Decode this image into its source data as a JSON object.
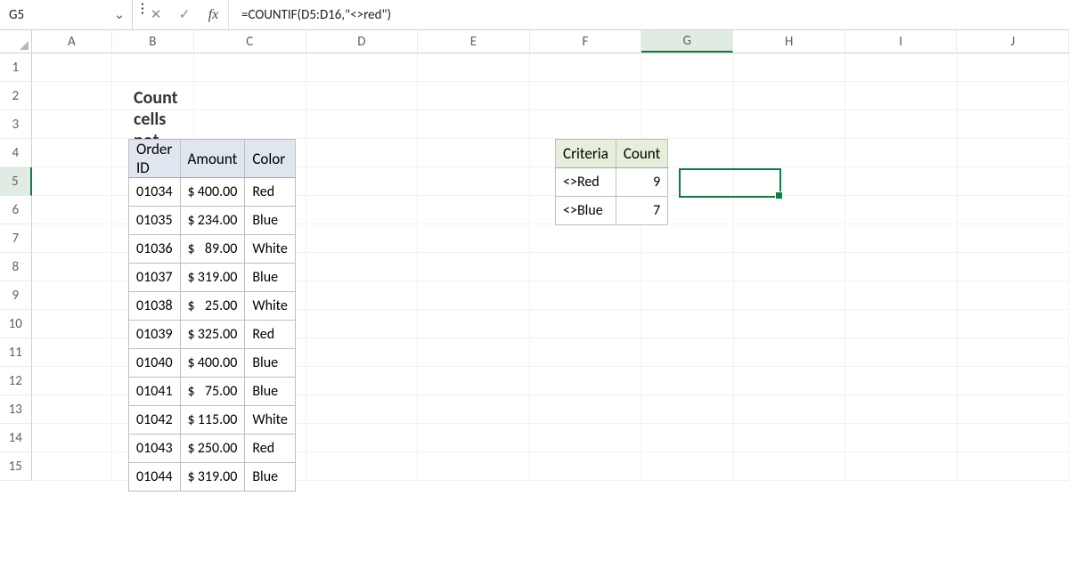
{
  "name_box": "G5",
  "formula": "=COUNTIF(D5:D16,\"<>red\")",
  "columns": [
    "A",
    "B",
    "C",
    "D",
    "E",
    "F",
    "G",
    "H",
    "I",
    "J"
  ],
  "active_col": "G",
  "row_labels": [
    "1",
    "2",
    "3",
    "4",
    "5",
    "6",
    "7",
    "8",
    "9",
    "10",
    "11",
    "12",
    "13",
    "14",
    "15"
  ],
  "active_row": "5",
  "title": "Count cells not equal to",
  "main_headers": {
    "id": "Order ID",
    "amount": "Amount",
    "color": "Color"
  },
  "main_rows": [
    {
      "id": "01034",
      "amount": "400.00",
      "color": "Red"
    },
    {
      "id": "01035",
      "amount": "234.00",
      "color": "Blue"
    },
    {
      "id": "01036",
      "amount": "89.00",
      "color": "White"
    },
    {
      "id": "01037",
      "amount": "319.00",
      "color": "Blue"
    },
    {
      "id": "01038",
      "amount": "25.00",
      "color": "White"
    },
    {
      "id": "01039",
      "amount": "325.00",
      "color": "Red"
    },
    {
      "id": "01040",
      "amount": "400.00",
      "color": "Blue"
    },
    {
      "id": "01041",
      "amount": "75.00",
      "color": "Blue"
    },
    {
      "id": "01042",
      "amount": "115.00",
      "color": "White"
    },
    {
      "id": "01043",
      "amount": "250.00",
      "color": "Red"
    },
    {
      "id": "01044",
      "amount": "319.00",
      "color": "Blue"
    }
  ],
  "currency": "$",
  "crit_headers": {
    "criteria": "Criteria",
    "count": "Count"
  },
  "crit_rows": [
    {
      "criteria": "<>Red",
      "count": "9"
    },
    {
      "criteria": "<>Blue",
      "count": "7"
    }
  ],
  "icons": {
    "dd": "⌄",
    "cancel": "✕",
    "enter": "✓",
    "fx": "fx"
  },
  "chart_data": {
    "type": "table",
    "title": "Count cells not equal to",
    "tables": [
      {
        "name": "orders",
        "columns": [
          "Order ID",
          "Amount",
          "Color"
        ],
        "rows": [
          [
            "01034",
            400.0,
            "Red"
          ],
          [
            "01035",
            234.0,
            "Blue"
          ],
          [
            "01036",
            89.0,
            "White"
          ],
          [
            "01037",
            319.0,
            "Blue"
          ],
          [
            "01038",
            25.0,
            "White"
          ],
          [
            "01039",
            325.0,
            "Red"
          ],
          [
            "01040",
            400.0,
            "Blue"
          ],
          [
            "01041",
            75.0,
            "Blue"
          ],
          [
            "01042",
            115.0,
            "White"
          ],
          [
            "01043",
            250.0,
            "Red"
          ],
          [
            "01044",
            319.0,
            "Blue"
          ]
        ]
      },
      {
        "name": "criteria_counts",
        "columns": [
          "Criteria",
          "Count"
        ],
        "rows": [
          [
            "<>Red",
            9
          ],
          [
            "<>Blue",
            7
          ]
        ]
      }
    ],
    "selected_cell": "G5",
    "selected_formula": "=COUNTIF(D5:D16,\"<>red\")"
  }
}
